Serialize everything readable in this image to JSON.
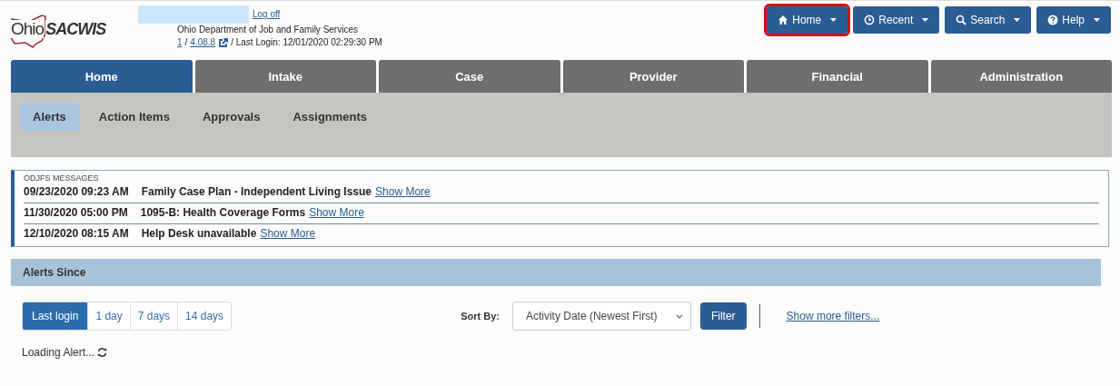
{
  "header": {
    "logo": {
      "part_1": "Ohio",
      "part_2": "SACWIS"
    },
    "logoff": "Log off",
    "agency": "Ohio Department of Job and Family Services",
    "instance": "1",
    "separator_1": "/",
    "version": "4.08.8",
    "last_login": "/ Last Login: 12/01/2020 02:29:30 PM"
  },
  "nav_buttons": [
    {
      "label": "Home",
      "kind": "home",
      "highlighted": true
    },
    {
      "label": "Recent",
      "kind": "clock",
      "highlighted": false
    },
    {
      "label": "Search",
      "kind": "search",
      "highlighted": false
    },
    {
      "label": "Help",
      "kind": "help",
      "highlighted": false
    }
  ],
  "tabs": [
    {
      "label": "Home",
      "selected": true
    },
    {
      "label": "Intake",
      "selected": false
    },
    {
      "label": "Case",
      "selected": false
    },
    {
      "label": "Provider",
      "selected": false
    },
    {
      "label": "Financial",
      "selected": false
    },
    {
      "label": "Administration",
      "selected": false
    }
  ],
  "subtabs": [
    {
      "label": "Alerts",
      "selected": true
    },
    {
      "label": "Action Items",
      "selected": false
    },
    {
      "label": "Approvals",
      "selected": false
    },
    {
      "label": "Assignments",
      "selected": false
    }
  ],
  "messages": {
    "title": "ODJFS MESSAGES",
    "items": [
      {
        "time": "09/23/2020 09:23 AM",
        "text": "Family Case Plan - Independent Living Issue",
        "link": "Show More"
      },
      {
        "time": "11/30/2020 05:00 PM",
        "text": "1095-B: Health Coverage Forms",
        "link": "Show More"
      },
      {
        "time": "12/10/2020 08:15 AM",
        "text": "Help Desk unavailable",
        "link": "Show More"
      }
    ]
  },
  "alerts_since": {
    "title": "Alerts Since",
    "ranges": [
      {
        "label": "Last login",
        "selected": true
      },
      {
        "label": "1 day",
        "selected": false
      },
      {
        "label": "7 days",
        "selected": false
      },
      {
        "label": "14 days",
        "selected": false
      }
    ],
    "sort_label": "Sort By:",
    "sort_value": "Activity Date (Newest First)",
    "filter_button": "Filter",
    "more_filters": "Show more filters...",
    "loading": "Loading Alert..."
  }
}
